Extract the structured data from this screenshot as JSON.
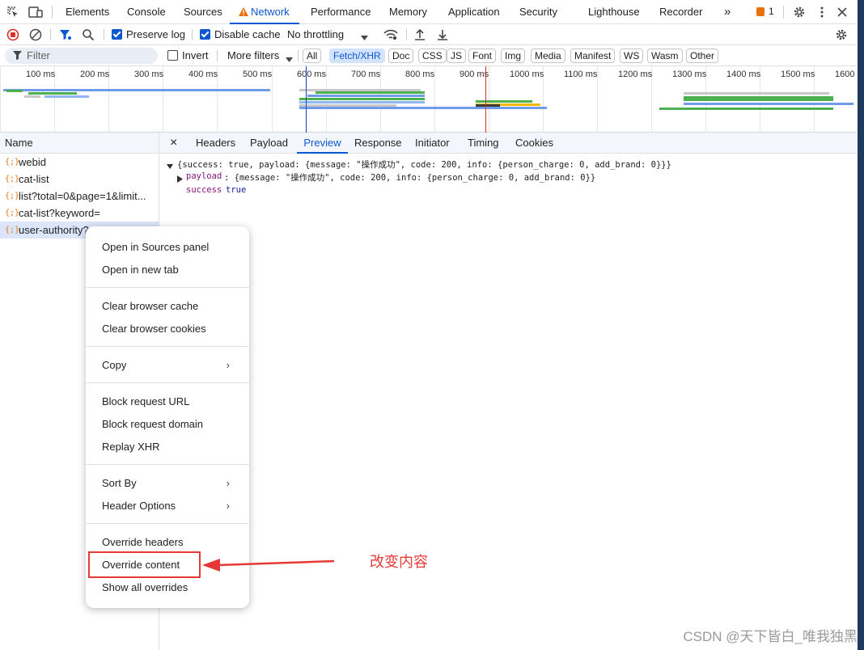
{
  "top_tabs": {
    "tabs": [
      "Elements",
      "Console",
      "Sources",
      "Network",
      "Performance",
      "Memory",
      "Application",
      "Security",
      "Lighthouse",
      "Recorder"
    ],
    "active": "Network",
    "more_label": "»",
    "issues_count": "1"
  },
  "toolbar1": {
    "preserve_log": "Preserve log",
    "disable_cache": "Disable cache",
    "throttling": "No throttling"
  },
  "toolbar2": {
    "filter_placeholder": "Filter",
    "invert": "Invert",
    "more_filters": "More filters",
    "chips": [
      "All",
      "Fetch/XHR",
      "Doc",
      "CSS",
      "JS",
      "Font",
      "Img",
      "Media",
      "Manifest",
      "WS",
      "Wasm",
      "Other"
    ],
    "selected_chip": "Fetch/XHR"
  },
  "overview": {
    "ticks": [
      "100 ms",
      "200 ms",
      "300 ms",
      "400 ms",
      "500 ms",
      "600 ms",
      "700 ms",
      "800 ms",
      "900 ms",
      "1000 ms",
      "1100 ms",
      "1200 ms",
      "1300 ms",
      "1400 ms",
      "1500 ms",
      "1600"
    ]
  },
  "requests": {
    "header": "Name",
    "items": [
      "webid",
      "cat-list",
      "list?total=0&page=1&limit...",
      "cat-list?keyword=",
      "user-authority?"
    ],
    "selected_index": 4
  },
  "detail": {
    "close": "×",
    "tabs": [
      "Headers",
      "Payload",
      "Preview",
      "Response",
      "Initiator",
      "Timing",
      "Cookies"
    ],
    "active": "Preview",
    "line1": "{success: true, payload: {message: \"操作成功\", code: 200, info: {person_charge: 0, add_brand: 0}}}",
    "line2_key": "payload",
    "line2_val": ": {message: \"操作成功\", code: 200, info: {person_charge: 0, add_brand: 0}}",
    "line3_key": "success",
    "line3_val": "true"
  },
  "context_menu": {
    "open_in_sources": "Open in Sources panel",
    "open_new_tab": "Open in new tab",
    "clear_cache": "Clear browser cache",
    "clear_cookies": "Clear browser cookies",
    "copy": "Copy",
    "block_url": "Block request URL",
    "block_domain": "Block request domain",
    "replay": "Replay XHR",
    "sort_by": "Sort By",
    "header_options": "Header Options",
    "override_headers": "Override headers",
    "override_content": "Override content",
    "show_overrides": "Show all overrides"
  },
  "annotation": "改变内容",
  "watermark": "CSDN @天下皆白_唯我独黑",
  "colors": {
    "accent": "#0b57d0",
    "highlight": "#e53935",
    "selected_row": "#dbe6fa"
  }
}
